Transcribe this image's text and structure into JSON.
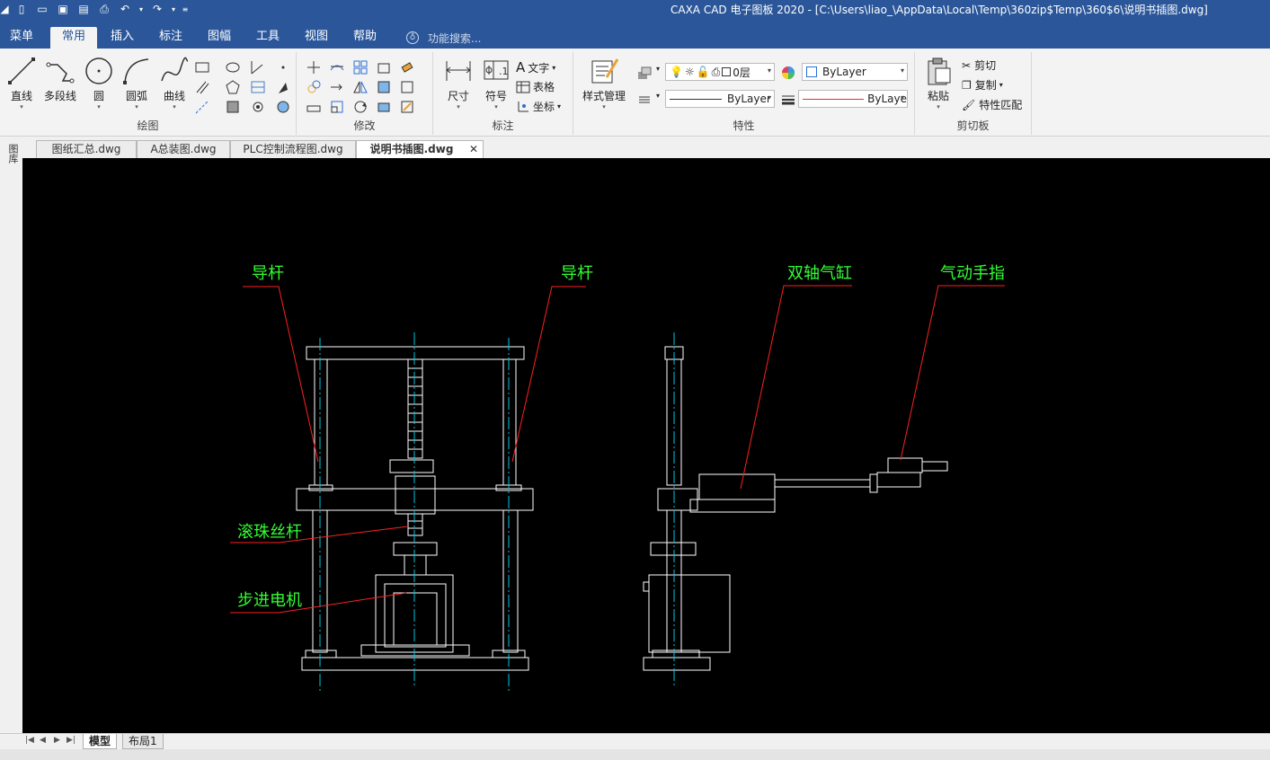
{
  "window": {
    "title": "CAXA CAD 电子图板 2020 - [C:\\Users\\liao_\\AppData\\Local\\Temp\\360zip$Temp\\360$6\\说明书插图.dwg]"
  },
  "ribbon_tabs": [
    {
      "label": "菜单",
      "active": false
    },
    {
      "label": "常用",
      "active": true
    },
    {
      "label": "插入",
      "active": false
    },
    {
      "label": "标注",
      "active": false
    },
    {
      "label": "图幅",
      "active": false
    },
    {
      "label": "工具",
      "active": false
    },
    {
      "label": "视图",
      "active": false
    },
    {
      "label": "帮助",
      "active": false
    }
  ],
  "search": {
    "placeholder": "功能搜索..."
  },
  "groups": {
    "draw": {
      "label": "绘图",
      "buttons": [
        "直线",
        "多段线",
        "圆",
        "圆弧",
        "曲线"
      ]
    },
    "modify": {
      "label": "修改"
    },
    "annotate": {
      "label": "标注",
      "buttons": [
        "尺寸",
        "符号"
      ],
      "small": [
        "文字",
        "表格",
        "坐标"
      ]
    },
    "properties": {
      "label": "特性",
      "style_button": "样式管理",
      "layer_value": "0层",
      "color_value": "ByLayer",
      "linetype_value": "ByLayer",
      "lineweight_value": "ByLaye"
    },
    "clipboard": {
      "label": "剪切板",
      "paste": "粘贴",
      "small": [
        "剪切",
        "复制",
        "特性匹配"
      ]
    }
  },
  "doc_tabs": [
    {
      "label": "图纸汇总.dwg",
      "active": false
    },
    {
      "label": "A总装图.dwg",
      "active": false
    },
    {
      "label": "PLC控制流程图.dwg",
      "active": false
    },
    {
      "label": "说明书插图.dwg",
      "active": true
    }
  ],
  "side_panel": {
    "label": "图库"
  },
  "drawing": {
    "labels": {
      "left_guide": "导杆",
      "right_guide": "导杆",
      "cylinder": "双轴气缸",
      "gripper": "气动手指",
      "ball_screw": "滚珠丝杆",
      "stepper": "步进电机"
    },
    "colors": {
      "background": "#000000",
      "outline": "#ffffff",
      "centerline": "#00c8e0",
      "leader": "#ff2020",
      "label": "#33ff33"
    }
  },
  "layout_tabs": [
    {
      "label": "模型",
      "active": true
    },
    {
      "label": "布局1",
      "active": false
    }
  ]
}
